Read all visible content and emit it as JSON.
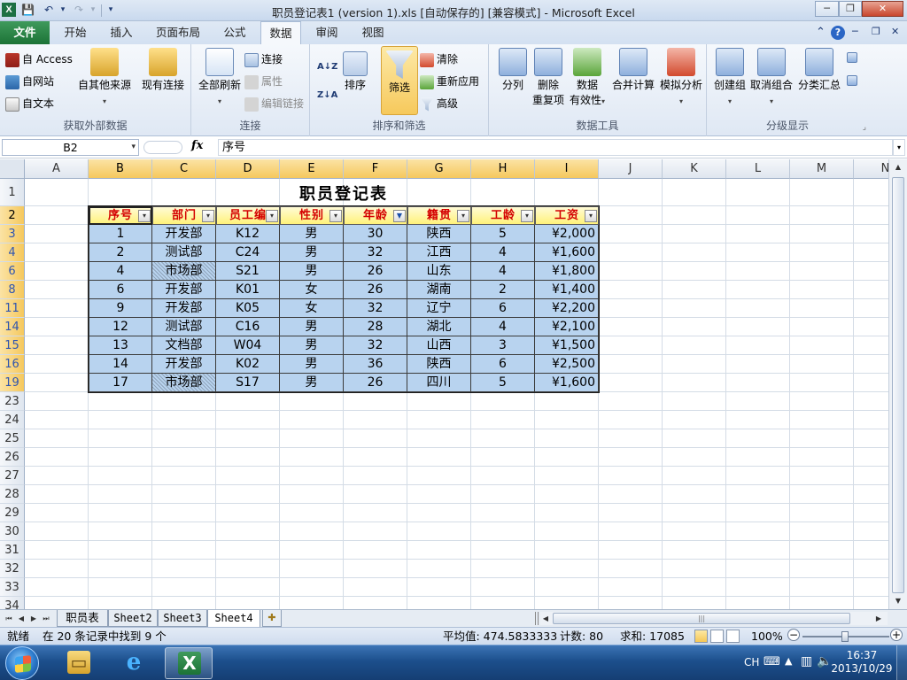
{
  "window": {
    "title": "职员登记表1 (version 1).xls [自动保存的] [兼容模式] - Microsoft Excel",
    "app_icon": "X",
    "minimize": "─",
    "restore": "❐",
    "close": "✕"
  },
  "quick_access": {
    "save": "💾",
    "undo": "↶",
    "redo": "↷",
    "customize": "▾"
  },
  "ribbon_tabs": [
    "文件",
    "开始",
    "插入",
    "页面布局",
    "公式",
    "数据",
    "审阅",
    "视图"
  ],
  "active_tab": "数据",
  "ribbon": {
    "groups": {
      "external": {
        "label": "获取外部数据",
        "access": "自 Access",
        "web": "自网站",
        "text": "自文本",
        "other_line1": "自其他来源",
        "existing": "现有连接"
      },
      "connections": {
        "label": "连接",
        "refresh_all": "全部刷新",
        "connections": "连接",
        "properties": "属性",
        "edit_links": "编辑链接"
      },
      "sort_filter": {
        "label": "排序和筛选",
        "sort_az": "A↓Z",
        "sort_za": "Z↓A",
        "sort": "排序",
        "filter": "筛选",
        "clear": "清除",
        "reapply": "重新应用",
        "advanced": "高级"
      },
      "data_tools": {
        "label": "数据工具",
        "text_to_columns": "分列",
        "remove_dup_1": "删除",
        "remove_dup_2": "重复项",
        "validation_1": "数据",
        "validation_2": "有效性",
        "consolidate": "合并计算",
        "whatif": "模拟分析"
      },
      "outline": {
        "label": "分级显示",
        "group": "创建组",
        "ungroup": "取消组合",
        "subtotal": "分类汇总"
      }
    }
  },
  "formula_bar": {
    "name_box": "B2",
    "fx": "fx",
    "content": "序号"
  },
  "sheet": {
    "columns": [
      "A",
      "B",
      "C",
      "D",
      "E",
      "F",
      "G",
      "H",
      "I",
      "J",
      "K",
      "L",
      "M",
      "N"
    ],
    "rows": [
      "1",
      "2",
      "3",
      "4",
      "6",
      "8",
      "11",
      "14",
      "15",
      "16",
      "19",
      "23",
      "24",
      "25",
      "26",
      "27",
      "28",
      "29",
      "30",
      "31",
      "32",
      "33",
      "34"
    ],
    "title": "职员登记表",
    "headers": [
      "序号",
      "部门",
      "员工编",
      "性别",
      "年龄",
      "籍贯",
      "工龄",
      "工资"
    ],
    "filter_button": "▾",
    "filter_active_button": "▼",
    "data": [
      [
        "1",
        "开发部",
        "K12",
        "男",
        "30",
        "陕西",
        "5",
        "¥2,000"
      ],
      [
        "2",
        "测试部",
        "C24",
        "男",
        "32",
        "江西",
        "4",
        "¥1,600"
      ],
      [
        "4",
        "市场部",
        "S21",
        "男",
        "26",
        "山东",
        "4",
        "¥1,800"
      ],
      [
        "6",
        "开发部",
        "K01",
        "女",
        "26",
        "湖南",
        "2",
        "¥1,400"
      ],
      [
        "9",
        "开发部",
        "K05",
        "女",
        "32",
        "辽宁",
        "6",
        "¥2,200"
      ],
      [
        "12",
        "测试部",
        "C16",
        "男",
        "28",
        "湖北",
        "4",
        "¥2,100"
      ],
      [
        "13",
        "文档部",
        "W04",
        "男",
        "32",
        "山西",
        "3",
        "¥1,500"
      ],
      [
        "14",
        "开发部",
        "K02",
        "男",
        "36",
        "陕西",
        "6",
        "¥2,500"
      ],
      [
        "17",
        "市场部",
        "S17",
        "男",
        "26",
        "四川",
        "5",
        "¥1,600"
      ]
    ]
  },
  "sheet_tabs": [
    "职员表",
    "Sheet2",
    "Sheet3",
    "Sheet4"
  ],
  "active_sheet": "Sheet4",
  "status_bar": {
    "ready": "就绪",
    "found": "在 20 条记录中找到 9 个",
    "average": "平均值: 474.5833333",
    "count": "计数: 80",
    "sum": "求和: 17085",
    "zoom": "100%"
  },
  "taskbar": {
    "lang": "CH",
    "time": "16:37",
    "date": "2013/10/29"
  },
  "colors": {
    "header_fill": "#fff27a",
    "header_text": "#d40000",
    "data_fill": "#b8d3ef",
    "file_tab": "#1c7336"
  }
}
